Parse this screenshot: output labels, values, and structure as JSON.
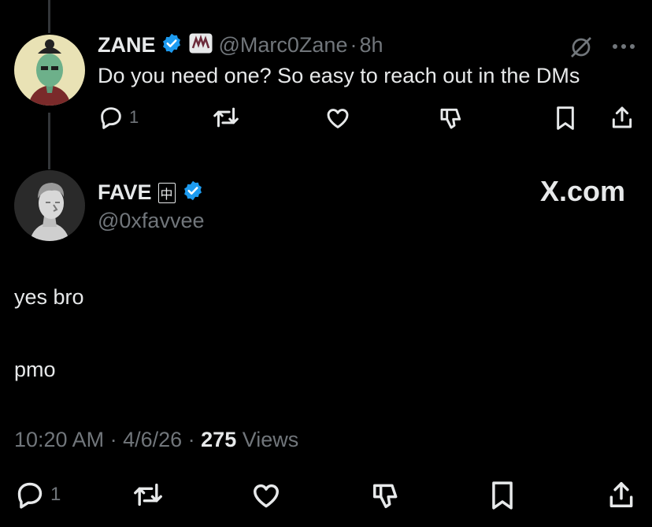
{
  "reply": {
    "display_name": "ZANE",
    "handle": "@Marc0Zane",
    "dot": "·",
    "age": "8h",
    "text": "Do you need one? So easy to reach out in the DMs",
    "reply_count": "1"
  },
  "main": {
    "display_name": "FAVE",
    "flair_glyph": "中",
    "handle": "@0xfavvee",
    "line1": "yes bro",
    "line2": "pmo",
    "time": "10:20 AM",
    "sep1": " · ",
    "date": "4/6/26",
    "sep2": " · ",
    "views_count": "275",
    "views_label": " Views",
    "reply_count": "1"
  },
  "watermark": "X.com",
  "colors": {
    "verified": "#1d9bf0",
    "muted": "#71767b",
    "text": "#e7e9ea"
  },
  "icons": [
    "reply-icon",
    "repost-icon",
    "like-icon",
    "dislike-icon",
    "bookmark-icon",
    "share-icon",
    "grok-icon",
    "more-icon",
    "verified-icon"
  ]
}
